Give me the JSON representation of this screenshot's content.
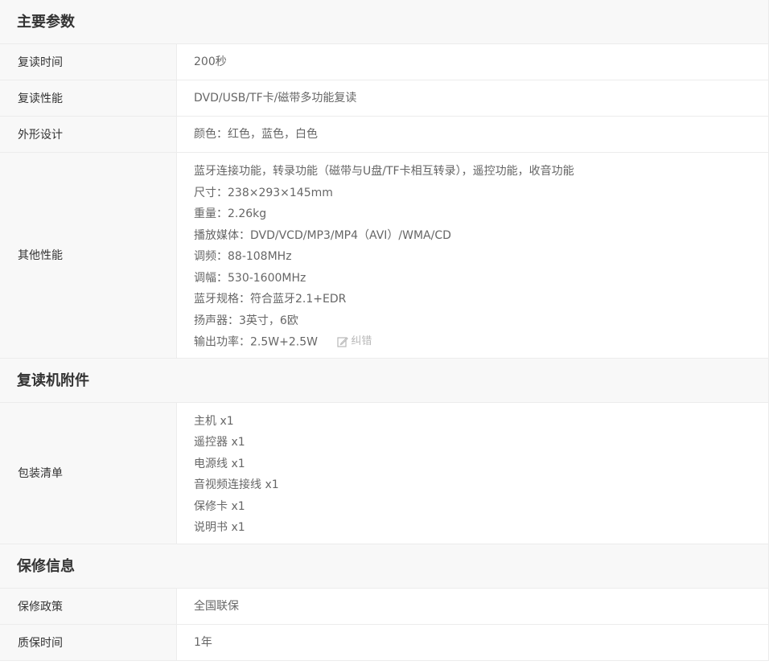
{
  "sections": [
    {
      "title": "主要参数",
      "rows": [
        {
          "label": "复读时间",
          "lines": [
            "200秒"
          ]
        },
        {
          "label": "复读性能",
          "lines": [
            "DVD/USB/TF卡/磁带多功能复读"
          ]
        },
        {
          "label": "外形设计",
          "lines": [
            "颜色：红色，蓝色，白色"
          ]
        },
        {
          "label": "其他性能",
          "lines": [
            "蓝牙连接功能，转录功能（磁带与U盘/TF卡相互转录），遥控功能，收音功能",
            "尺寸：238×293×145mm",
            "重量：2.26kg",
            "播放媒体：DVD/VCD/MP3/MP4（AVI）/WMA/CD",
            "调频：88-108MHz",
            "调幅：530-1600MHz",
            "蓝牙规格：符合蓝牙2.1+EDR",
            "扬声器：3英寸，6欧",
            "输出功率：2.5W+2.5W"
          ]
        }
      ]
    },
    {
      "title": "复读机附件",
      "rows": [
        {
          "label": "包装清单",
          "lines": [
            "主机 x1",
            "遥控器 x1",
            "电源线 x1",
            "音视频连接线 x1",
            "保修卡 x1",
            "说明书 x1"
          ]
        }
      ]
    },
    {
      "title": "保修信息",
      "rows": [
        {
          "label": "保修政策",
          "lines": [
            "全国联保"
          ]
        },
        {
          "label": "质保时间",
          "lines": [
            "1年"
          ]
        }
      ]
    }
  ],
  "correct_link": {
    "label": "纠错",
    "icon": "edit-icon"
  }
}
